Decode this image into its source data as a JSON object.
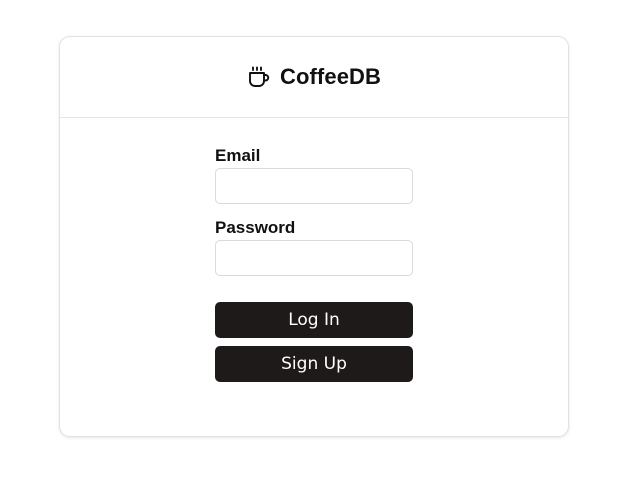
{
  "header": {
    "logo_icon": "coffee-cup-icon",
    "title": "CoffeeDB"
  },
  "form": {
    "email_label": "Email",
    "email_value": "",
    "email_placeholder": "",
    "password_label": "Password",
    "password_value": "",
    "password_placeholder": "",
    "login_label": "Log In",
    "signup_label": "Sign Up"
  },
  "colors": {
    "button_background": "#1e1a19",
    "button_text": "#ffffff",
    "card_border": "#e2e2e2",
    "input_border": "#dadada"
  }
}
